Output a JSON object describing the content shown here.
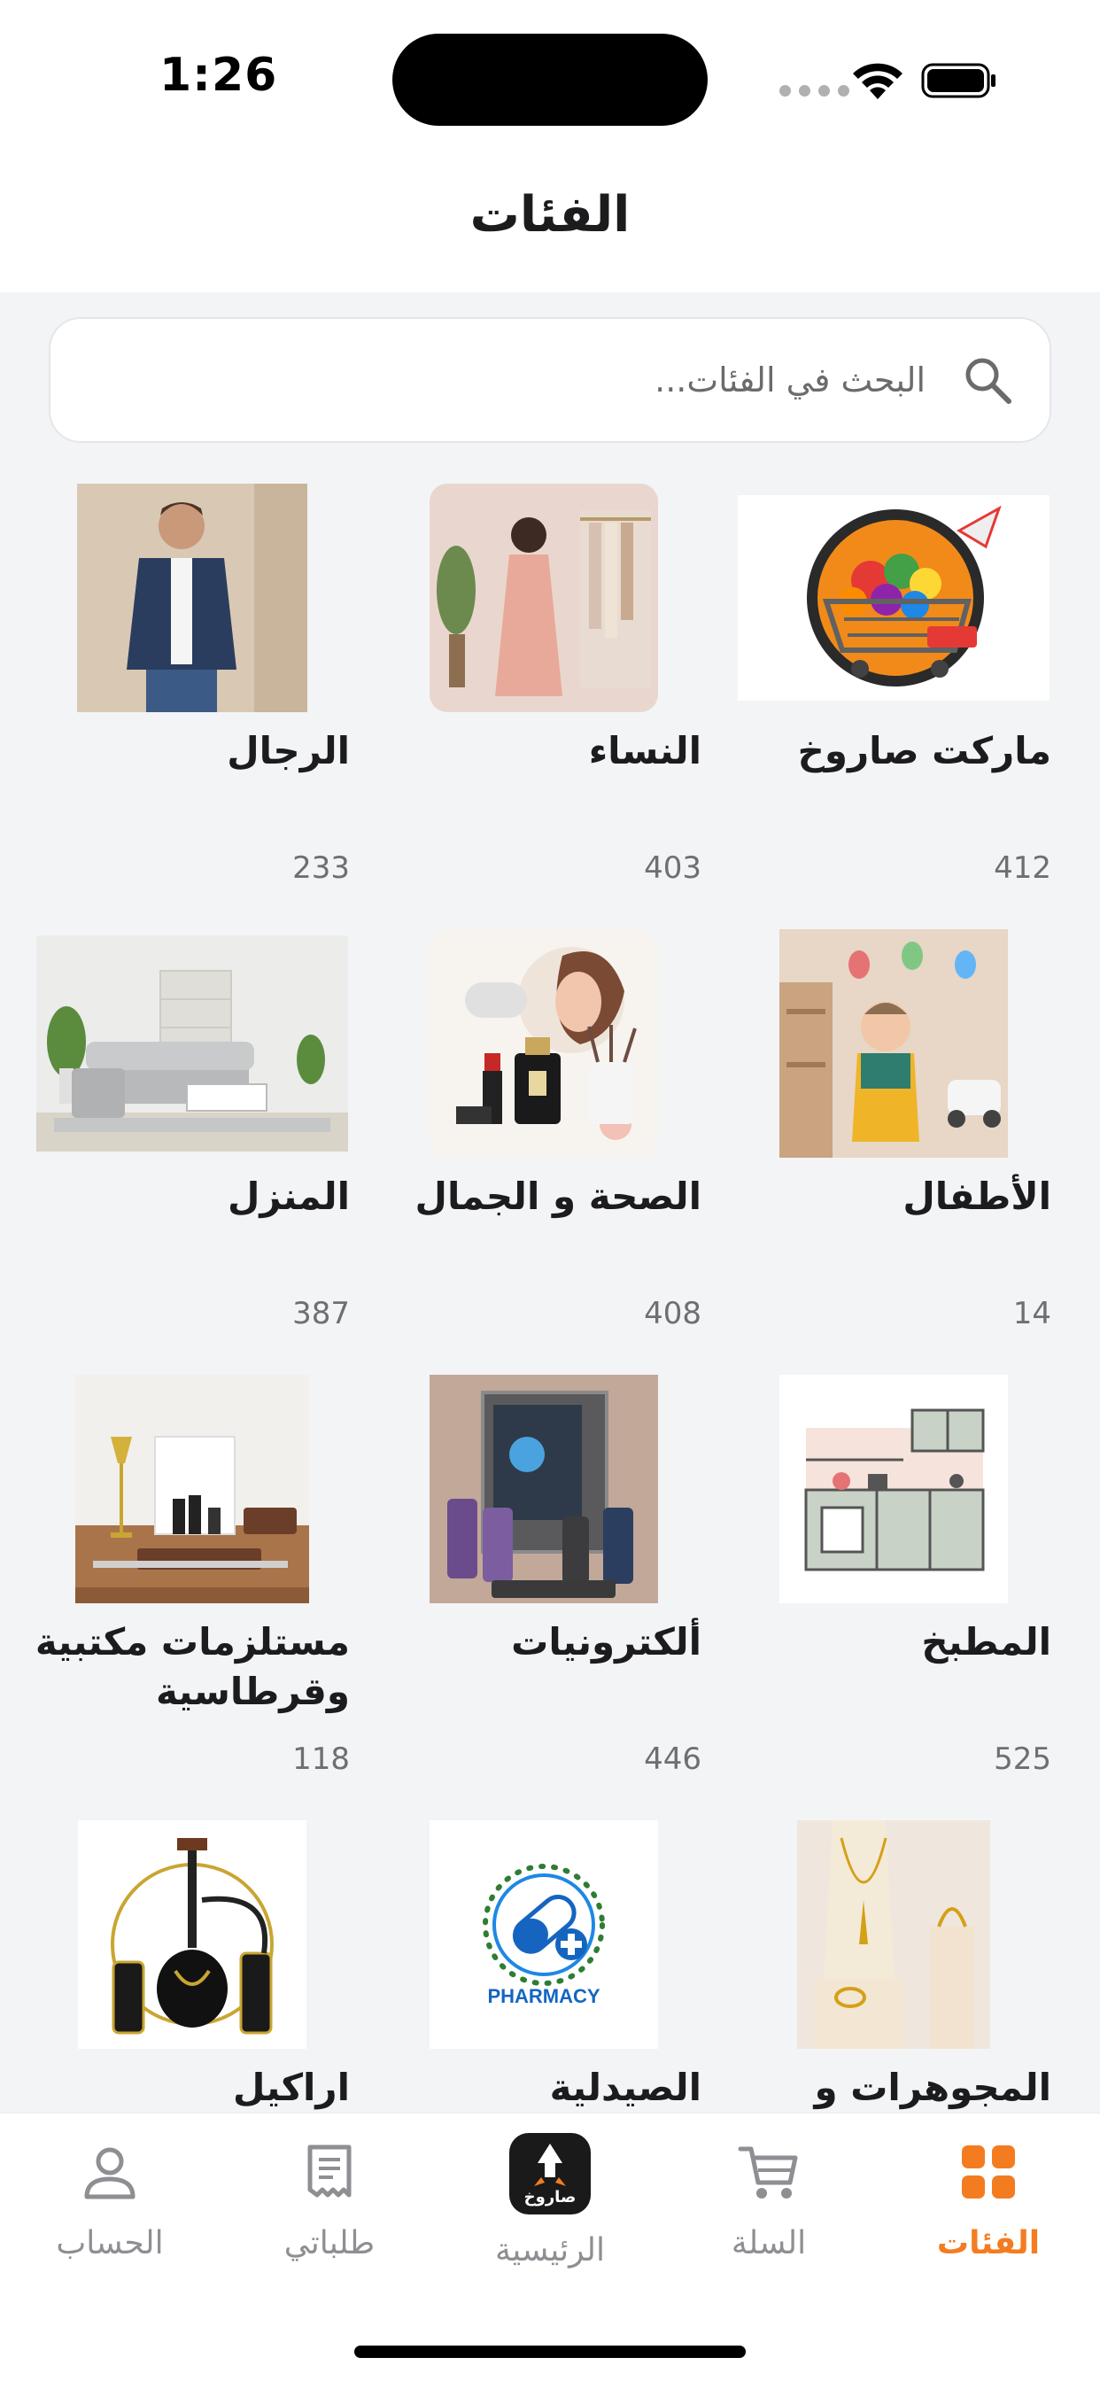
{
  "status_bar": {
    "time": "1:26"
  },
  "header": {
    "title": "الفئات"
  },
  "search": {
    "placeholder": "البحث في الفئات..."
  },
  "categories": [
    {
      "name": "ماركت صاروخ",
      "count": "412",
      "icon": "shopping-cart-image"
    },
    {
      "name": "النساء",
      "count": "403",
      "icon": "women-fashion-image"
    },
    {
      "name": "الرجال",
      "count": "233",
      "icon": "men-fashion-image"
    },
    {
      "name": "الأطفال",
      "count": "14",
      "icon": "kids-image"
    },
    {
      "name": "الصحة و الجمال",
      "count": "408",
      "icon": "beauty-image"
    },
    {
      "name": "المنزل",
      "count": "387",
      "icon": "home-sofa-image"
    },
    {
      "name": "المطبخ",
      "count": "525",
      "icon": "kitchen-image"
    },
    {
      "name": "ألكترونيات",
      "count": "446",
      "icon": "electronics-image"
    },
    {
      "name": "مستلزمات مكتبية وقرطاسية",
      "count": "118",
      "icon": "office-supplies-image"
    },
    {
      "name": "المجوهرات و",
      "count": "",
      "icon": "jewelry-image"
    },
    {
      "name": "الصيدلية",
      "count": "",
      "icon": "pharmacy-image",
      "image_text": "PHARMACY"
    },
    {
      "name": "اراكيل",
      "count": "",
      "icon": "hookah-image"
    }
  ],
  "tabbar": {
    "account": "الحساب",
    "orders": "طلباتي",
    "home": "الرئيسية",
    "cart": "السلة",
    "categories": "الفئات",
    "logo_text": "صاروخ"
  },
  "colors": {
    "accent": "#f47c20",
    "inactive": "#8e8e93",
    "background": "#f3f4f6"
  }
}
